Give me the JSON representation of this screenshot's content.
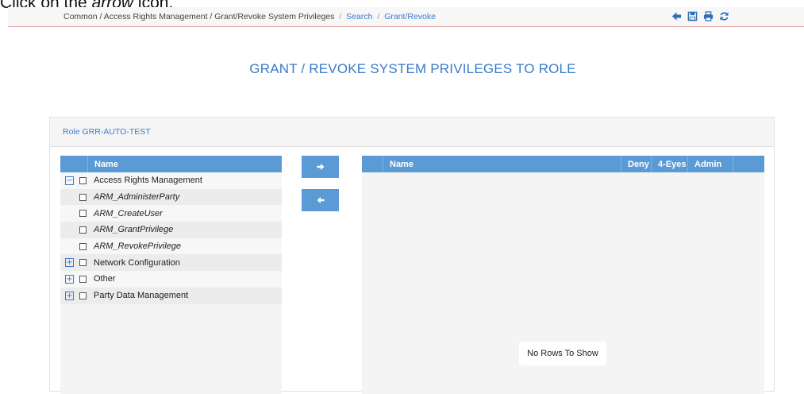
{
  "instruction": {
    "prefix": "Click on the ",
    "emphasis": "arrow",
    "suffix": " icon."
  },
  "breadcrumb": {
    "path": "Common / Access Rights Management / Grant/Revoke System Privileges",
    "sep1": "/",
    "search": "Search",
    "sep2": "/",
    "current": "Grant/Revoke"
  },
  "toolbar": [
    "back-arrow-icon",
    "save-icon",
    "print-icon",
    "refresh-icon"
  ],
  "page_title": "GRANT / REVOKE SYSTEM PRIVILEGES TO ROLE",
  "panel": {
    "header": "Role GRR-AUTO-TEST"
  },
  "left_grid": {
    "header": "Name",
    "rows": [
      {
        "label": "Access Rights Management",
        "expander": "⊟",
        "italic": false
      },
      {
        "label": "ARM_AdministerParty",
        "expander": "",
        "italic": true
      },
      {
        "label": "ARM_CreateUser",
        "expander": "",
        "italic": true
      },
      {
        "label": "ARM_GrantPrivilege",
        "expander": "",
        "italic": true
      },
      {
        "label": "ARM_RevokePrivilege",
        "expander": "",
        "italic": true
      },
      {
        "label": "Network Configuration",
        "expander": "⊞",
        "italic": false
      },
      {
        "label": "Other",
        "expander": "⊞",
        "italic": false
      },
      {
        "label": "Party Data Management",
        "expander": "⊞",
        "italic": false
      }
    ]
  },
  "right_grid": {
    "headers": {
      "name": "Name",
      "deny": "Deny",
      "four_eyes": "4-Eyes",
      "admin": "Admin"
    },
    "empty_message": "No Rows To Show"
  },
  "buttons": {
    "add": "right-arrow-icon",
    "remove": "left-arrow-icon"
  },
  "colors": {
    "accent": "#5b9bd5",
    "link": "#3a7bc8"
  }
}
